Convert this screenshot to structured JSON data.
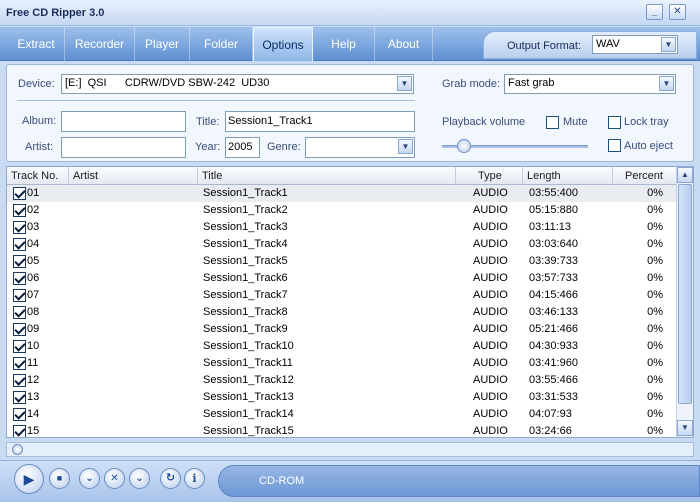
{
  "window": {
    "title": "Free CD Ripper 3.0"
  },
  "menu": {
    "tabs": [
      {
        "label": "Extract"
      },
      {
        "label": "Recorder"
      },
      {
        "label": "Player"
      },
      {
        "label": "Folder"
      },
      {
        "label": "Options"
      },
      {
        "label": "Help"
      },
      {
        "label": "About"
      }
    ],
    "active_tab": "Options",
    "output_format_label": "Output Format:",
    "output_format_value": "WAV"
  },
  "settings": {
    "device_label": "Device:",
    "device_value": "[E:]  QSI      CDRW/DVD SBW-242  UD30",
    "grab_mode_label": "Grab mode:",
    "grab_mode_value": "Fast grab",
    "album_label": "Album:",
    "album_value": "",
    "title_label": "Title:",
    "title_value": "Session1_Track1",
    "artist_label": "Artist:",
    "artist_value": "",
    "year_label": "Year:",
    "year_value": "2005",
    "genre_label": "Genre:",
    "genre_value": "",
    "playback_volume_label": "Playback volume",
    "mute_label": "Mute",
    "lock_tray_label": "Lock tray",
    "auto_eject_label": "Auto eject",
    "playback_volume_level": 0.15
  },
  "tracklist": {
    "columns": [
      "Track No.",
      "Artist",
      "Title",
      "Type",
      "Length",
      "Percent"
    ],
    "rows": [
      {
        "no": "01",
        "artist": "",
        "title": "Session1_Track1",
        "type": "AUDIO",
        "length": "03:55:400",
        "percent": "0%"
      },
      {
        "no": "02",
        "artist": "",
        "title": "Session1_Track2",
        "type": "AUDIO",
        "length": "05:15:880",
        "percent": "0%"
      },
      {
        "no": "03",
        "artist": "",
        "title": "Session1_Track3",
        "type": "AUDIO",
        "length": "03:11:13",
        "percent": "0%"
      },
      {
        "no": "04",
        "artist": "",
        "title": "Session1_Track4",
        "type": "AUDIO",
        "length": "03:03:640",
        "percent": "0%"
      },
      {
        "no": "05",
        "artist": "",
        "title": "Session1_Track5",
        "type": "AUDIO",
        "length": "03:39:733",
        "percent": "0%"
      },
      {
        "no": "06",
        "artist": "",
        "title": "Session1_Track6",
        "type": "AUDIO",
        "length": "03:57:733",
        "percent": "0%"
      },
      {
        "no": "07",
        "artist": "",
        "title": "Session1_Track7",
        "type": "AUDIO",
        "length": "04:15:466",
        "percent": "0%"
      },
      {
        "no": "08",
        "artist": "",
        "title": "Session1_Track8",
        "type": "AUDIO",
        "length": "03:46:133",
        "percent": "0%"
      },
      {
        "no": "09",
        "artist": "",
        "title": "Session1_Track9",
        "type": "AUDIO",
        "length": "05:21:466",
        "percent": "0%"
      },
      {
        "no": "10",
        "artist": "",
        "title": "Session1_Track10",
        "type": "AUDIO",
        "length": "04:30:933",
        "percent": "0%"
      },
      {
        "no": "11",
        "artist": "",
        "title": "Session1_Track11",
        "type": "AUDIO",
        "length": "03:41:960",
        "percent": "0%"
      },
      {
        "no": "12",
        "artist": "",
        "title": "Session1_Track12",
        "type": "AUDIO",
        "length": "03:55:466",
        "percent": "0%"
      },
      {
        "no": "13",
        "artist": "",
        "title": "Session1_Track13",
        "type": "AUDIO",
        "length": "03:31:533",
        "percent": "0%"
      },
      {
        "no": "14",
        "artist": "",
        "title": "Session1_Track14",
        "type": "AUDIO",
        "length": "04:07:93",
        "percent": "0%"
      },
      {
        "no": "15",
        "artist": "",
        "title": "Session1_Track15",
        "type": "AUDIO",
        "length": "03:24:66",
        "percent": "0%"
      }
    ]
  },
  "status": {
    "text": "CD-ROM"
  },
  "toolbar": {
    "icons": [
      "play-icon",
      "stop-icon",
      "rip-selected-icon",
      "rip-cancel-icon",
      "rip-all-icon",
      "refresh-icon",
      "info-icon"
    ]
  },
  "colors": {
    "accent": "#5f90d3",
    "panel": "#f2f6fd",
    "active_tab": "#cfe3fb"
  }
}
